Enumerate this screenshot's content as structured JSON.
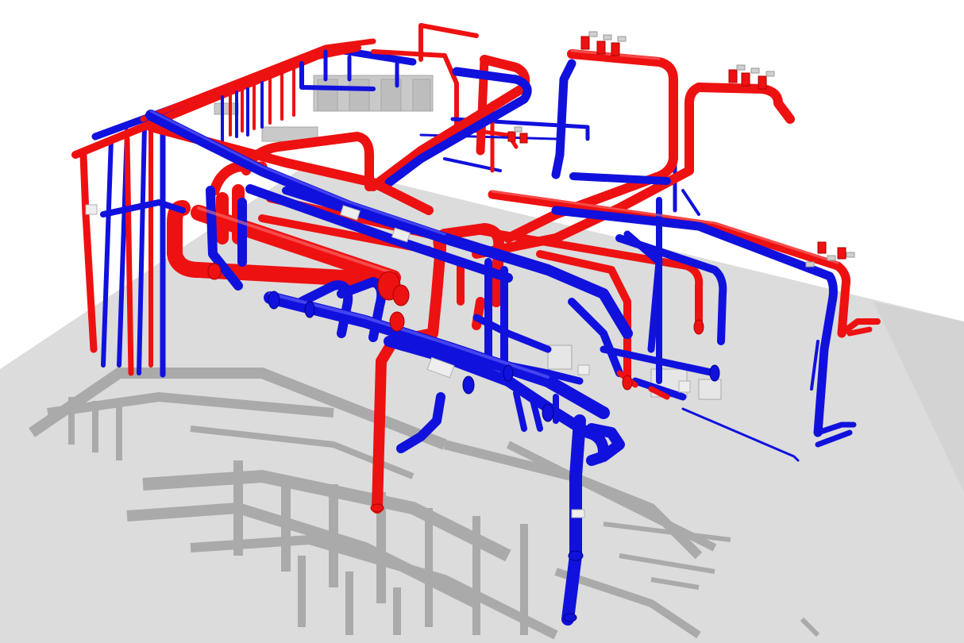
{
  "scene": {
    "background": "#ffffff",
    "floor_color": "#dcdcdc",
    "floor_edge_color": "#cfcfcf",
    "shadow_color": "#9a9a9a",
    "supply_color": "#ee1111",
    "supply_highlight": "#ff7a7a",
    "return_color": "#1111dd",
    "return_highlight": "#6f6fff",
    "equipment_color": "#c9c9c9"
  }
}
